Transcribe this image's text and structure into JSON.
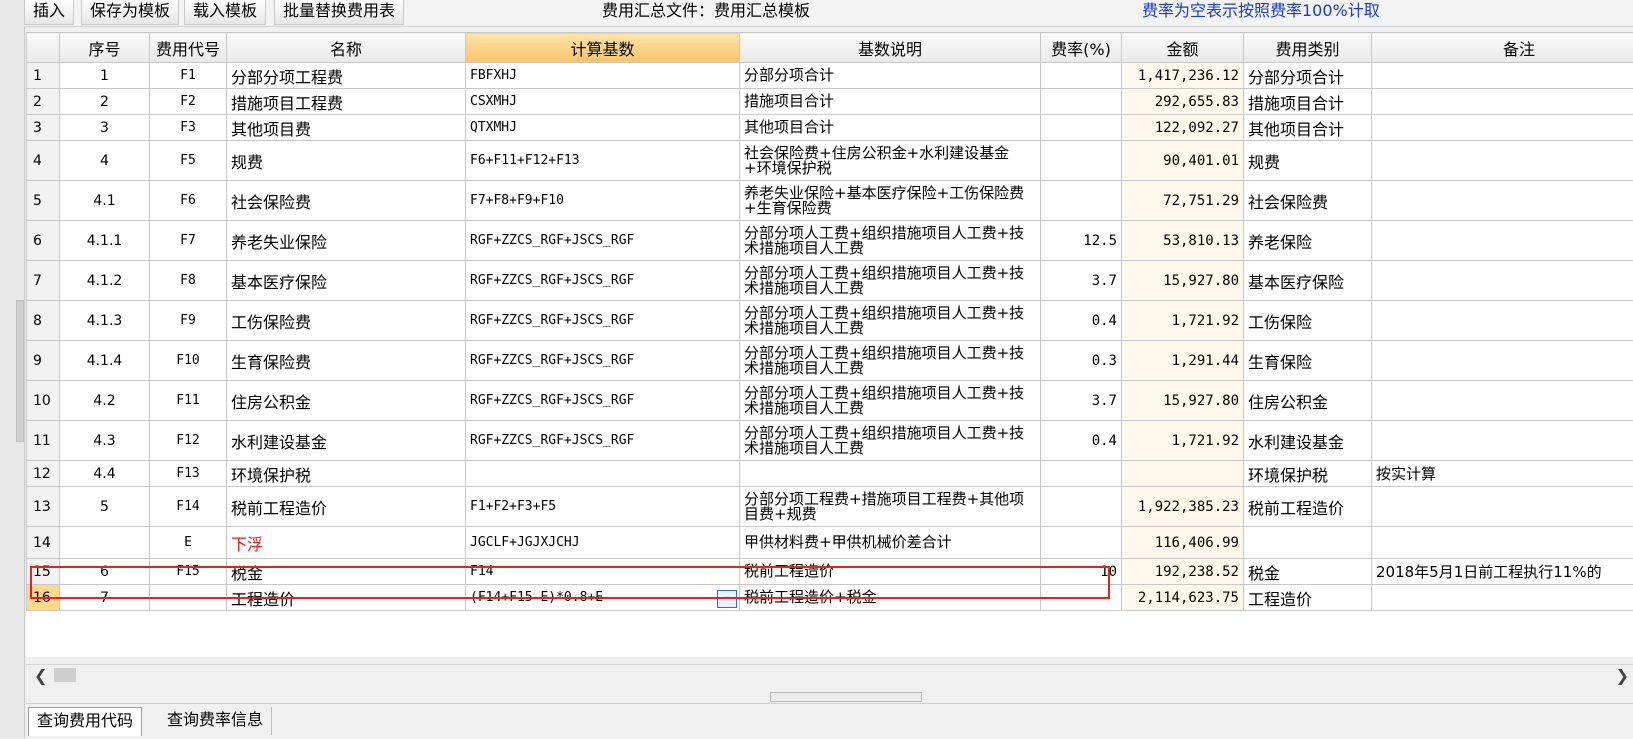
{
  "toolbar": {
    "insert_label": "插入",
    "save_template_label": "保存为模板",
    "load_template_label": "载入模板",
    "batch_replace_label": "批量替换费用表",
    "file_title": "费用汇总文件：费用汇总模板",
    "rate_note": "费率为空表示按照费率100%计取"
  },
  "grid": {
    "headers": {
      "seq": "序号",
      "code": "费用代号",
      "name": "名称",
      "base": "计算基数",
      "desc": "基数说明",
      "rate": "费率(%)",
      "amount": "金额",
      "category": "费用类别",
      "remark": "备注"
    },
    "rows": [
      {
        "num": "1",
        "seq": "1",
        "code": "F1",
        "name": "分部分项工程费",
        "base": "FBFXHJ",
        "desc": "分部分项合计",
        "rate": "",
        "amount": "1,417,236.12",
        "category": "分部分项合计",
        "remark": ""
      },
      {
        "num": "2",
        "seq": "2",
        "code": "F2",
        "name": "措施项目工程费",
        "base": "CSXMHJ",
        "desc": "措施项目合计",
        "rate": "",
        "amount": "292,655.83",
        "category": "措施项目合计",
        "remark": ""
      },
      {
        "num": "3",
        "seq": "3",
        "code": "F3",
        "name": "其他项目费",
        "base": "QTXMHJ",
        "desc": "其他项目合计",
        "rate": "",
        "amount": "122,092.27",
        "category": "其他项目合计",
        "remark": ""
      },
      {
        "num": "4",
        "seq": "4",
        "code": "F5",
        "name": "规费",
        "base": "F6+F11+F12+F13",
        "desc": "社会保险费+住房公积金+水利建设基金+环境保护税",
        "rate": "",
        "amount": "90,401.01",
        "category": "规费",
        "remark": ""
      },
      {
        "num": "5",
        "seq": "4.1",
        "code": "F6",
        "name": "社会保险费",
        "base": "F7+F8+F9+F10",
        "desc": "养老失业保险+基本医疗保险+工伤保险费+生育保险费",
        "rate": "",
        "amount": "72,751.29",
        "category": "社会保险费",
        "remark": ""
      },
      {
        "num": "6",
        "seq": "4.1.1",
        "code": "F7",
        "name": "养老失业保险",
        "base": "RGF+ZZCS_RGF+JSCS_RGF",
        "desc": "分部分项人工费+组织措施项目人工费+技术措施项目人工费",
        "rate": "12.5",
        "amount": "53,810.13",
        "category": "养老保险",
        "remark": ""
      },
      {
        "num": "7",
        "seq": "4.1.2",
        "code": "F8",
        "name": "基本医疗保险",
        "base": "RGF+ZZCS_RGF+JSCS_RGF",
        "desc": "分部分项人工费+组织措施项目人工费+技术措施项目人工费",
        "rate": "3.7",
        "amount": "15,927.80",
        "category": "基本医疗保险",
        "remark": ""
      },
      {
        "num": "8",
        "seq": "4.1.3",
        "code": "F9",
        "name": "工伤保险费",
        "base": "RGF+ZZCS_RGF+JSCS_RGF",
        "desc": "分部分项人工费+组织措施项目人工费+技术措施项目人工费",
        "rate": "0.4",
        "amount": "1,721.92",
        "category": "工伤保险",
        "remark": ""
      },
      {
        "num": "9",
        "seq": "4.1.4",
        "code": "F10",
        "name": "生育保险费",
        "base": "RGF+ZZCS_RGF+JSCS_RGF",
        "desc": "分部分项人工费+组织措施项目人工费+技术措施项目人工费",
        "rate": "0.3",
        "amount": "1,291.44",
        "category": "生育保险",
        "remark": ""
      },
      {
        "num": "10",
        "seq": "4.2",
        "code": "F11",
        "name": "住房公积金",
        "base": "RGF+ZZCS_RGF+JSCS_RGF",
        "desc": "分部分项人工费+组织措施项目人工费+技术措施项目人工费",
        "rate": "3.7",
        "amount": "15,927.80",
        "category": "住房公积金",
        "remark": ""
      },
      {
        "num": "11",
        "seq": "4.3",
        "code": "F12",
        "name": "水利建设基金",
        "base": "RGF+ZZCS_RGF+JSCS_RGF",
        "desc": "分部分项人工费+组织措施项目人工费+技术措施项目人工费",
        "rate": "0.4",
        "amount": "1,721.92",
        "category": "水利建设基金",
        "remark": ""
      },
      {
        "num": "12",
        "seq": "4.4",
        "code": "F13",
        "name": "环境保护税",
        "base": "",
        "desc": "",
        "rate": "",
        "amount": "",
        "category": "环境保护税",
        "remark": "按实计算"
      },
      {
        "num": "13",
        "seq": "5",
        "code": "F14",
        "name": "税前工程造价",
        "base": "F1+F2+F3+F5",
        "desc": "分部分项工程费+措施项目工程费+其他项目费+规费",
        "rate": "",
        "amount": "1,922,385.23",
        "category": "税前工程造价",
        "remark": ""
      },
      {
        "num": "14",
        "seq": "",
        "code": "E",
        "name": "下浮",
        "base": "JGCLF+JGJXJCHJ",
        "desc": "甲供材料费+甲供机械价差合计",
        "rate": "",
        "amount": "116,406.99",
        "category": "",
        "remark": ""
      },
      {
        "num": "15",
        "seq": "6",
        "code": "F15",
        "name": "税金",
        "base": "F14",
        "desc": "税前工程造价",
        "rate": "10",
        "amount": "192,238.52",
        "category": "税金",
        "remark": "2018年5月1日前工程执行11%的"
      },
      {
        "num": "16",
        "seq": "7",
        "code": "",
        "name": "工程造价",
        "base": "(F14+F15-E)*0.8+E",
        "desc": "税前工程造价+税金",
        "rate": "",
        "amount": "2,114,623.75",
        "category": "工程造价",
        "remark": ""
      }
    ]
  },
  "bottom_tabs": {
    "query_code_label": "查询费用代码",
    "query_rate_label": "查询费率信息"
  },
  "colors": {
    "highlight": "#e52222",
    "accent_header": "#f7c46a",
    "note_blue": "#1a3cc8"
  }
}
